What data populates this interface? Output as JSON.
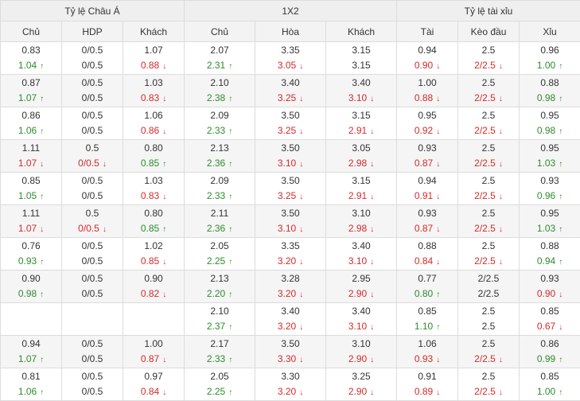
{
  "groups": [
    {
      "label": "Tỷ lệ Châu Á",
      "span": 3
    },
    {
      "label": "1X2",
      "span": 3
    },
    {
      "label": "Tỷ lệ tài xỉu",
      "span": 3
    }
  ],
  "columns": [
    "Chủ",
    "HDP",
    "Khách",
    "Chủ",
    "Hòa",
    "Khách",
    "Tài",
    "Kèo đầu",
    "Xỉu"
  ],
  "colors": {
    "up": "#2e8b2e",
    "down": "#d42a2a",
    "header_bg": "#efefef",
    "stripe": "#f5f5f5"
  },
  "arrows": {
    "up": "↑",
    "down": "↓"
  },
  "rows": [
    [
      [
        "0.83",
        "1.04",
        "up"
      ],
      [
        "0/0.5",
        "0/0.5",
        ""
      ],
      [
        "1.07",
        "0.88",
        "down"
      ],
      [
        "2.07",
        "2.31",
        "up"
      ],
      [
        "3.35",
        "3.05",
        "down"
      ],
      [
        "3.15",
        "3.15",
        ""
      ],
      [
        "0.94",
        "0.90",
        "down"
      ],
      [
        "2.5",
        "2/2.5",
        "down"
      ],
      [
        "0.96",
        "1.00",
        "up"
      ]
    ],
    [
      [
        "0.87",
        "1.07",
        "up"
      ],
      [
        "0/0.5",
        "0/0.5",
        ""
      ],
      [
        "1.03",
        "0.83",
        "down"
      ],
      [
        "2.10",
        "2.38",
        "up"
      ],
      [
        "3.40",
        "3.25",
        "down"
      ],
      [
        "3.40",
        "3.10",
        "down"
      ],
      [
        "1.00",
        "0.88",
        "down"
      ],
      [
        "2.5",
        "2/2.5",
        "down"
      ],
      [
        "0.88",
        "0.98",
        "up"
      ]
    ],
    [
      [
        "0.86",
        "1.06",
        "up"
      ],
      [
        "0/0.5",
        "0/0.5",
        ""
      ],
      [
        "1.06",
        "0.86",
        "down"
      ],
      [
        "2.09",
        "2.33",
        "up"
      ],
      [
        "3.50",
        "3.25",
        "down"
      ],
      [
        "3.15",
        "2.91",
        "down"
      ],
      [
        "0.95",
        "0.92",
        "down"
      ],
      [
        "2.5",
        "2/2.5",
        "down"
      ],
      [
        "0.95",
        "0.98",
        "up"
      ]
    ],
    [
      [
        "1.11",
        "1.07",
        "down"
      ],
      [
        "0.5",
        "0/0.5",
        "down"
      ],
      [
        "0.80",
        "0.85",
        "up"
      ],
      [
        "2.13",
        "2.36",
        "up"
      ],
      [
        "3.50",
        "3.10",
        "down"
      ],
      [
        "3.05",
        "2.98",
        "down"
      ],
      [
        "0.93",
        "0.87",
        "down"
      ],
      [
        "2.5",
        "2/2.5",
        "down"
      ],
      [
        "0.95",
        "1.03",
        "up"
      ]
    ],
    [
      [
        "0.85",
        "1.05",
        "up"
      ],
      [
        "0/0.5",
        "0/0.5",
        ""
      ],
      [
        "1.03",
        "0.83",
        "down"
      ],
      [
        "2.09",
        "2.33",
        "up"
      ],
      [
        "3.50",
        "3.25",
        "down"
      ],
      [
        "3.15",
        "2.91",
        "down"
      ],
      [
        "0.94",
        "0.91",
        "down"
      ],
      [
        "2.5",
        "2/2.5",
        "down"
      ],
      [
        "0.93",
        "0.96",
        "up"
      ]
    ],
    [
      [
        "1.11",
        "1.07",
        "down"
      ],
      [
        "0.5",
        "0/0.5",
        "down"
      ],
      [
        "0.80",
        "0.85",
        "up"
      ],
      [
        "2.11",
        "2.36",
        "up"
      ],
      [
        "3.50",
        "3.10",
        "down"
      ],
      [
        "3.10",
        "2.98",
        "down"
      ],
      [
        "0.93",
        "0.87",
        "down"
      ],
      [
        "2.5",
        "2/2.5",
        "down"
      ],
      [
        "0.95",
        "1.03",
        "up"
      ]
    ],
    [
      [
        "0.76",
        "0.93",
        "up"
      ],
      [
        "0/0.5",
        "0/0.5",
        ""
      ],
      [
        "1.02",
        "0.85",
        "down"
      ],
      [
        "2.05",
        "2.25",
        "up"
      ],
      [
        "3.35",
        "3.20",
        "down"
      ],
      [
        "3.40",
        "3.10",
        "down"
      ],
      [
        "0.88",
        "0.84",
        "down"
      ],
      [
        "2.5",
        "2/2.5",
        "down"
      ],
      [
        "0.88",
        "0.94",
        "up"
      ]
    ],
    [
      [
        "0.90",
        "0.98",
        "up"
      ],
      [
        "0/0.5",
        "0/0.5",
        ""
      ],
      [
        "0.90",
        "0.82",
        "down"
      ],
      [
        "2.13",
        "2.20",
        "up"
      ],
      [
        "3.28",
        "3.20",
        "down"
      ],
      [
        "2.95",
        "2.90",
        "down"
      ],
      [
        "0.77",
        "0.80",
        "up"
      ],
      [
        "2/2.5",
        "2/2.5",
        ""
      ],
      [
        "0.93",
        "0.90",
        "down"
      ]
    ],
    [
      [
        "",
        "",
        ""
      ],
      [
        "",
        "",
        ""
      ],
      [
        "",
        "",
        ""
      ],
      [
        "2.10",
        "2.37",
        "up"
      ],
      [
        "3.40",
        "3.20",
        "down"
      ],
      [
        "3.40",
        "3.10",
        "down"
      ],
      [
        "0.85",
        "1.10",
        "up"
      ],
      [
        "2.5",
        "2.5",
        ""
      ],
      [
        "0.85",
        "0.67",
        "down"
      ]
    ],
    [
      [
        "0.94",
        "1.07",
        "up"
      ],
      [
        "0/0.5",
        "0/0.5",
        ""
      ],
      [
        "1.00",
        "0.87",
        "down"
      ],
      [
        "2.17",
        "2.33",
        "up"
      ],
      [
        "3.50",
        "3.30",
        "down"
      ],
      [
        "3.10",
        "2.90",
        "down"
      ],
      [
        "1.06",
        "0.93",
        "down"
      ],
      [
        "2.5",
        "2/2.5",
        "down"
      ],
      [
        "0.86",
        "0.99",
        "up"
      ]
    ],
    [
      [
        "0.81",
        "1.06",
        "up"
      ],
      [
        "0/0.5",
        "0/0.5",
        ""
      ],
      [
        "0.97",
        "0.84",
        "down"
      ],
      [
        "2.05",
        "2.25",
        "up"
      ],
      [
        "3.30",
        "3.20",
        "down"
      ],
      [
        "3.25",
        "2.90",
        "down"
      ],
      [
        "0.91",
        "0.89",
        "down"
      ],
      [
        "2.5",
        "2/2.5",
        "down"
      ],
      [
        "0.85",
        "1.00",
        "up"
      ]
    ]
  ]
}
